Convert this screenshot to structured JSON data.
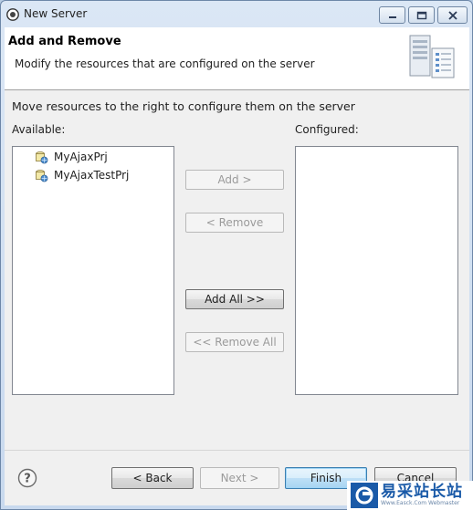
{
  "window": {
    "title": "New Server",
    "controls": {
      "minimize": "minimize-icon",
      "maximize": "maximize-icon",
      "close": "close-icon"
    }
  },
  "banner": {
    "title": "Add and Remove",
    "description": "Modify the resources that are configured on the server",
    "image_icon": "server-icon"
  },
  "instruction": "Move resources to the right to configure them on the server",
  "available": {
    "label": "Available:",
    "items": [
      {
        "label": "MyAjaxPrj",
        "icon": "web-project-icon"
      },
      {
        "label": "MyAjaxTestPrj",
        "icon": "web-project-icon"
      }
    ]
  },
  "configured": {
    "label": "Configured:",
    "items": []
  },
  "buttons": {
    "add": "Add >",
    "remove": "< Remove",
    "add_all": "Add All >>",
    "remove_all": "<< Remove All"
  },
  "footer": {
    "help_icon": "help-icon",
    "back": "< Back",
    "next": "Next >",
    "finish": "Finish",
    "cancel": "Cancel"
  },
  "watermark": {
    "text": "易采站长站",
    "subtext": "Www.Easck.Com Webmaster"
  },
  "colors": {
    "window_frame": "#c8d9ee",
    "default_button": "#a7d5f2",
    "watermark_blue": "#1a5aa8"
  }
}
